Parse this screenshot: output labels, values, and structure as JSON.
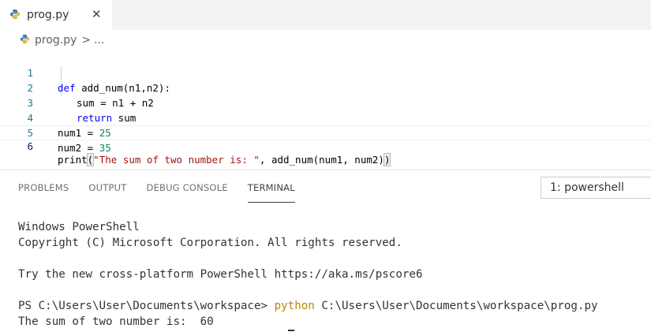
{
  "tab": {
    "label": "prog.py",
    "close_glyph": "✕",
    "icon": "python-icon"
  },
  "breadcrumb": {
    "file": "prog.py",
    "separator": ">",
    "more": "..."
  },
  "editor": {
    "lines": [
      {
        "n": "1",
        "text": "def add_num(n1,n2):"
      },
      {
        "n": "2",
        "text": "sum = n1 + n2"
      },
      {
        "n": "3",
        "text": "return sum"
      },
      {
        "n": "4",
        "text": "num1 = 25"
      },
      {
        "n": "5",
        "text": "num2 = 35"
      },
      {
        "n": "6",
        "text": "print(\"The sum of two number is: \", add_num(num1, num2))"
      }
    ],
    "current_line": 6
  },
  "panel": {
    "tabs": [
      "PROBLEMS",
      "OUTPUT",
      "DEBUG CONSOLE",
      "TERMINAL"
    ],
    "active_tab": "TERMINAL",
    "terminal_selector": "1: powershell"
  },
  "terminal": {
    "line1": "Windows PowerShell",
    "line2": "Copyright (C) Microsoft Corporation. All rights reserved.",
    "line3": "Try the new cross-platform PowerShell https://aka.ms/pscore6",
    "prompt": "PS C:\\Users\\User\\Documents\\workspace> ",
    "command": "python",
    "command_arg": " C:\\Users\\User\\Documents\\workspace\\prog.py",
    "output": "The sum of two number is:  60"
  },
  "colors": {
    "keyword": "#0000ff",
    "number": "#098658",
    "string": "#a31515",
    "line_number": "#237893",
    "command": "#b8860b"
  }
}
